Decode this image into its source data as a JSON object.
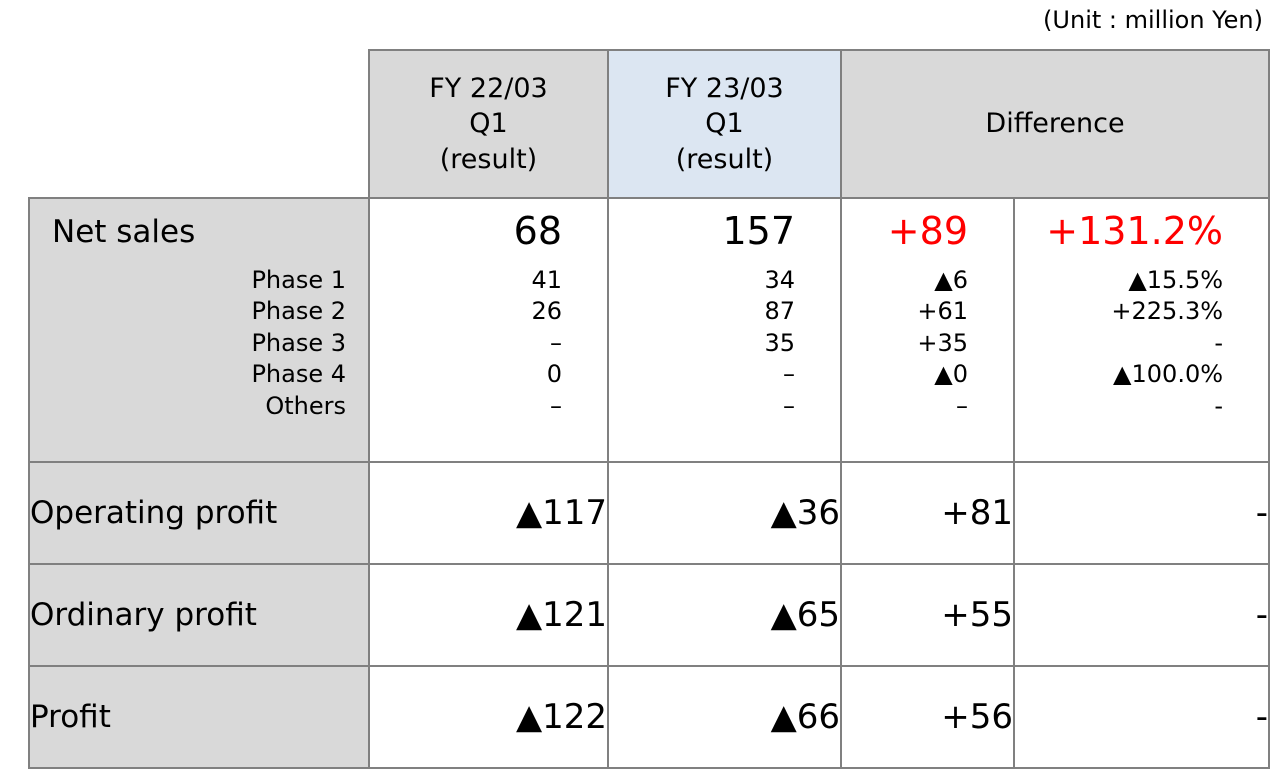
{
  "unit_caption": "(Unit : million Yen)",
  "table": {
    "columns": [
      {
        "key": "label",
        "header_lines": []
      },
      {
        "key": "fy22",
        "header_lines": [
          "FY 22/03",
          "Q1",
          "(result)"
        ],
        "bg": "#d9d9d9"
      },
      {
        "key": "fy23",
        "header_lines": [
          "FY 23/03",
          "Q1",
          "(result)"
        ],
        "bg": "#dce6f2"
      },
      {
        "key": "diff_abs",
        "header_lines": [
          "Difference"
        ],
        "bg": "#d9d9d9"
      },
      {
        "key": "diff_pct",
        "header_lines": [],
        "bg": "#d9d9d9"
      }
    ],
    "difference_header": "Difference",
    "net_sales": {
      "title": "Net sales",
      "sub_labels": [
        "Phase 1",
        "Phase 2",
        "Phase 3",
        "Phase 4",
        "Others"
      ],
      "fy22": {
        "total": "68",
        "subs": [
          "41",
          "26",
          "–",
          "0",
          "–"
        ]
      },
      "fy23": {
        "total": "157",
        "subs": [
          "34",
          "87",
          "35",
          "–",
          "–"
        ]
      },
      "diff_abs": {
        "total": "+89",
        "subs": [
          "▲6",
          "+61",
          "+35",
          "▲0",
          "–"
        ]
      },
      "diff_pct": {
        "total": "+131.2%",
        "subs": [
          "▲15.5%",
          "+225.3%",
          "-",
          "▲100.0%",
          "-"
        ]
      }
    },
    "rows": [
      {
        "label": "Operating profit",
        "fy22": "▲117",
        "fy23": "▲36",
        "diff_abs": "+81",
        "diff_pct": "-"
      },
      {
        "label": "Ordinary profit",
        "fy22": "▲121",
        "fy23": "▲65",
        "diff_abs": "+55",
        "diff_pct": "-"
      },
      {
        "label": "Profit",
        "fy22": "▲122",
        "fy23": "▲66",
        "diff_abs": "+56",
        "diff_pct": "-"
      }
    ]
  },
  "colors": {
    "header_gray": "#d9d9d9",
    "header_blue": "#dce6f2",
    "highlight_red": "#ff0000",
    "border": "#808080"
  }
}
